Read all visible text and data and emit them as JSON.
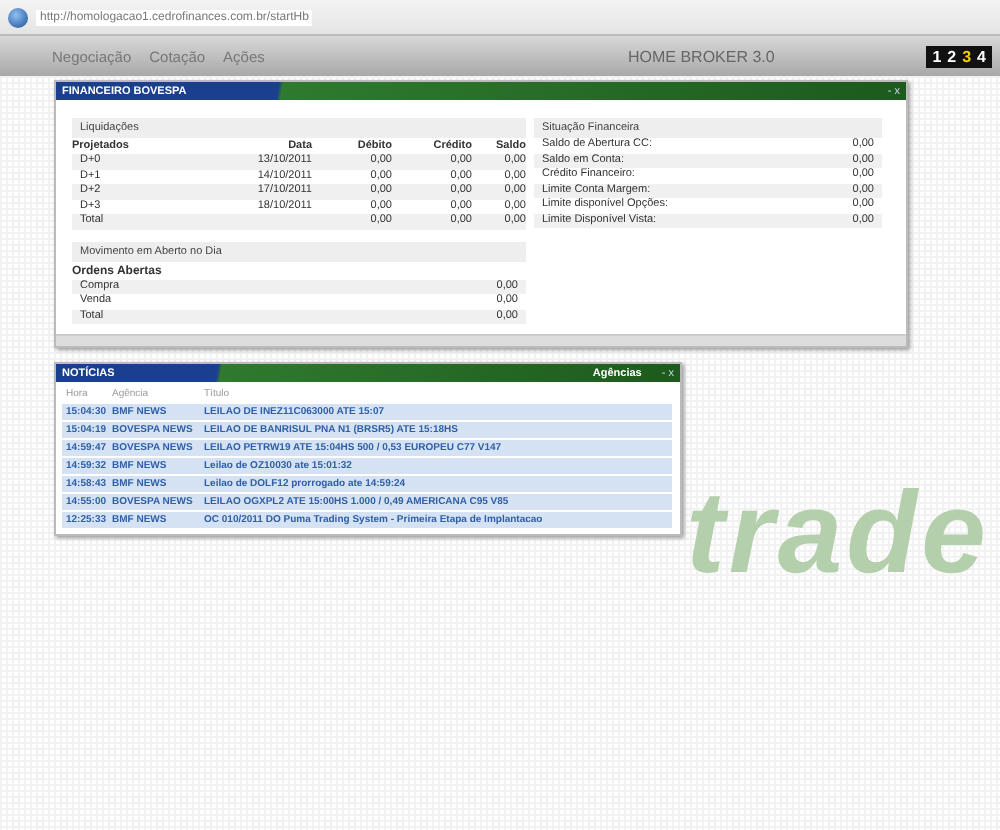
{
  "address_bar": {
    "url": "http://homologacao1.cedrofinances.com.br/startHb"
  },
  "nav": {
    "items": [
      {
        "label": "Negociação"
      },
      {
        "label": "Cotação"
      },
      {
        "label": "Ações"
      }
    ],
    "title": "HOME BROKER 3.0",
    "pages": [
      {
        "label": "1",
        "selected": false
      },
      {
        "label": "2",
        "selected": false
      },
      {
        "label": "3",
        "selected": true
      },
      {
        "label": "4",
        "selected": false
      }
    ]
  },
  "background_logo": "trade",
  "financeiro": {
    "title": "FINANCEIRO BOVESPA",
    "controls": "- x",
    "liquidacoes": {
      "title": "Liquidações",
      "columns": [
        "Projetados",
        "Data",
        "Débito",
        "Crédito",
        "Saldo"
      ],
      "rows": [
        [
          "D+0",
          "13/10/2011",
          "0,00",
          "0,00",
          "0,00"
        ],
        [
          "D+1",
          "14/10/2011",
          "0,00",
          "0,00",
          "0,00"
        ],
        [
          "D+2",
          "17/10/2011",
          "0,00",
          "0,00",
          "0,00"
        ],
        [
          "D+3",
          "18/10/2011",
          "0,00",
          "0,00",
          "0,00"
        ],
        [
          "Total",
          "",
          "0,00",
          "0,00",
          "0,00"
        ]
      ]
    },
    "movimento": {
      "title": "Movimento em Aberto no Dia",
      "subtitle": "Ordens Abertas",
      "rows": [
        [
          "Compra",
          "0,00"
        ],
        [
          "Venda",
          "0,00"
        ],
        [
          "Total",
          "0,00"
        ]
      ]
    },
    "situacao": {
      "title": "Situação Financeira",
      "rows": [
        [
          "Saldo de Abertura CC:",
          "0,00"
        ],
        [
          "Saldo em Conta:",
          "0,00"
        ],
        [
          "Crédito Financeiro:",
          "0,00"
        ],
        [
          "Limite Conta Margem:",
          "0,00"
        ],
        [
          "Limite disponível Opções:",
          "0,00"
        ],
        [
          "Limite Disponível Vista:",
          "0,00"
        ]
      ]
    }
  },
  "noticias": {
    "title": "NOTÍCIAS",
    "filter": "Agências",
    "controls": "- x",
    "columns": [
      "Hora",
      "Agência",
      "Título"
    ],
    "rows": [
      [
        "15:04:30",
        "BMF NEWS",
        "LEILAO DE INEZ11C063000 ATE 15:07"
      ],
      [
        "15:04:19",
        "BOVESPA NEWS",
        "LEILAO DE BANRISUL PNA N1 (BRSR5) ATE 15:18HS"
      ],
      [
        "14:59:47",
        "BOVESPA NEWS",
        "LEILAO PETRW19 ATE 15:04HS 500 / 0,53 EUROPEU C77 V147"
      ],
      [
        "14:59:32",
        "BMF NEWS",
        "Leilao de OZ10030 ate 15:01:32"
      ],
      [
        "14:58:43",
        "BMF NEWS",
        "Leilao de DOLF12 prorrogado ate 14:59:24"
      ],
      [
        "14:55:00",
        "BOVESPA NEWS",
        "LEILAO OGXPL2 ATE 15:00HS 1.000 / 0,49 AMERICANA C95 V85"
      ],
      [
        "12:25:33",
        "BMF NEWS",
        "OC 010/2011 DO Puma Trading System - Primeira Etapa de Implantacao"
      ]
    ]
  }
}
